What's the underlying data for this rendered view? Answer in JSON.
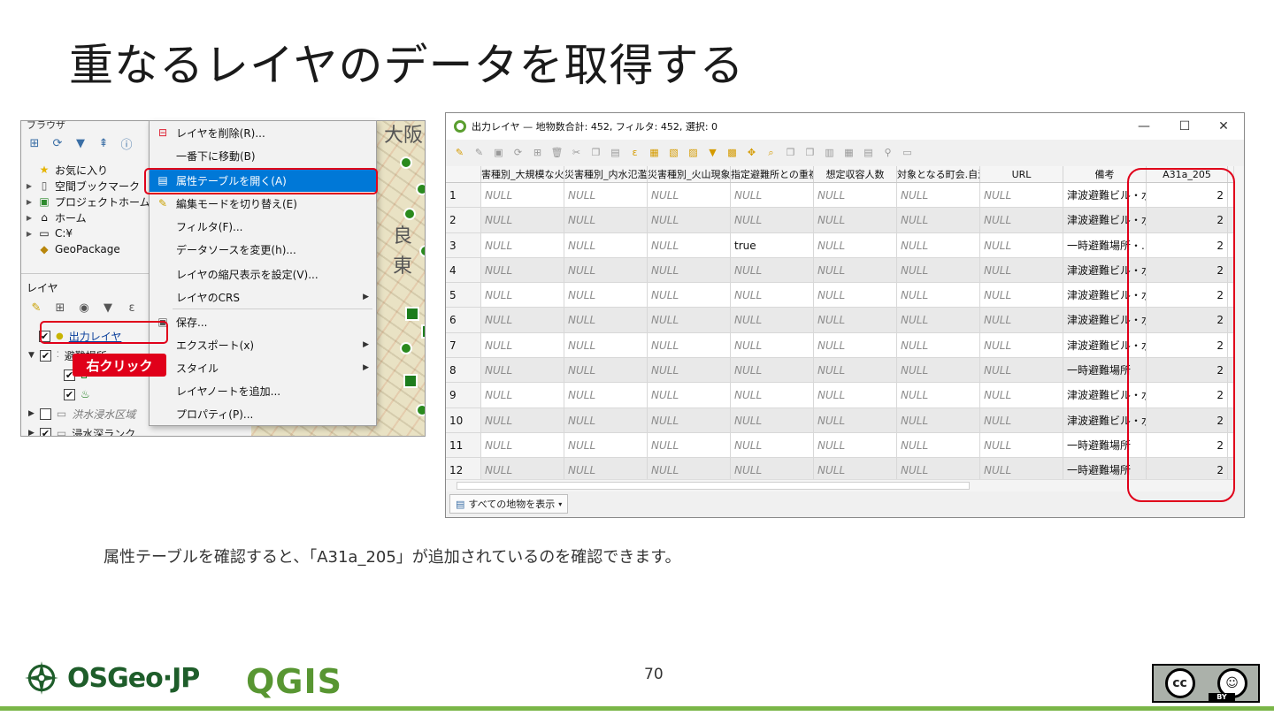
{
  "slide": {
    "title": "重なるレイヤのデータを取得する",
    "caption": "属性テーブルを確認すると、「A31a_205」が追加されているのを確認できます。",
    "page_number": "70"
  },
  "left_panel": {
    "cut_header": "ブラウザ",
    "browser_items": [
      {
        "label": "お気に入り",
        "icon": "star-icon"
      },
      {
        "label": "空間ブックマーク",
        "icon": "bookmark-icon"
      },
      {
        "label": "プロジェクトホーム",
        "icon": "project-home-icon"
      },
      {
        "label": "ホーム",
        "icon": "home-icon"
      },
      {
        "label": "C:¥",
        "icon": "folder-icon"
      },
      {
        "label": "GeoPackage",
        "icon": "geopackage-icon"
      }
    ],
    "layers_label": "レイヤ",
    "layers": [
      {
        "label": "出力レイヤ",
        "checked": "✔"
      },
      {
        "label": "避難場所",
        "checked": "✔"
      },
      {
        "label": "",
        "checked": "✔"
      },
      {
        "label": "",
        "checked": "✔"
      },
      {
        "label": "洪水浸水区域",
        "checked": ""
      },
      {
        "label": "浸水深ランク",
        "checked": "✔"
      }
    ],
    "right_click_label": "右クリック",
    "map_labels": [
      "大阪",
      "良",
      "東"
    ]
  },
  "context_menu": {
    "items": [
      {
        "label": "レイヤを削除(R)...",
        "icon": "remove-layer-icon"
      },
      {
        "label": "一番下に移動(B)",
        "icon": ""
      },
      {
        "label": "属性テーブルを開く(A)",
        "icon": "table-icon"
      },
      {
        "label": "編集モードを切り替え(E)",
        "icon": "pencil-icon"
      },
      {
        "label": "フィルタ(F)...",
        "icon": ""
      },
      {
        "label": "データソースを変更(h)...",
        "icon": ""
      },
      {
        "label": "レイヤの縮尺表示を設定(V)...",
        "icon": ""
      },
      {
        "label": "レイヤのCRS",
        "icon": ""
      },
      {
        "label": "保存...",
        "icon": "save-icon"
      },
      {
        "label": "エクスポート(x)",
        "icon": ""
      },
      {
        "label": "スタイル",
        "icon": ""
      },
      {
        "label": "レイヤノートを追加...",
        "icon": ""
      },
      {
        "label": "プロパティ(P)...",
        "icon": ""
      }
    ],
    "submenu_arrow": "▶"
  },
  "attribute_table": {
    "window_title": "出力レイヤ — 地物数合計: 452, フィルタ: 452, 選択: 0",
    "controls": {
      "minimize": "—",
      "maximize": "☐",
      "close": "✕"
    },
    "columns": [
      "",
      "災害種別_大規模な火",
      "災害種別_内水氾濫",
      "災害種別_火山現象",
      "指定避難所との重複",
      "想定収容人数",
      "対象となる町会.自治会",
      "URL",
      "備考",
      "A31a_205"
    ],
    "header_display": [
      "",
      "害種別_大規模な火",
      "災害種別_内水氾濫",
      "災害種別_火山現象",
      "指定避難所との重複",
      "想定収容人数",
      "対象となる町会.自治会",
      "URL",
      "備考",
      "A31a_205"
    ],
    "rows": [
      [
        "1",
        "NULL",
        "NULL",
        "NULL",
        "NULL",
        "NULL",
        "NULL",
        "NULL",
        "津波避難ビル・水...",
        "2"
      ],
      [
        "2",
        "NULL",
        "NULL",
        "NULL",
        "NULL",
        "NULL",
        "NULL",
        "NULL",
        "津波避難ビル・水...",
        "2"
      ],
      [
        "3",
        "NULL",
        "NULL",
        "NULL",
        "true",
        "NULL",
        "NULL",
        "NULL",
        "一時避難場所・...",
        "2"
      ],
      [
        "4",
        "NULL",
        "NULL",
        "NULL",
        "NULL",
        "NULL",
        "NULL",
        "NULL",
        "津波避難ビル・水...",
        "2"
      ],
      [
        "5",
        "NULL",
        "NULL",
        "NULL",
        "NULL",
        "NULL",
        "NULL",
        "NULL",
        "津波避難ビル・水...",
        "2"
      ],
      [
        "6",
        "NULL",
        "NULL",
        "NULL",
        "NULL",
        "NULL",
        "NULL",
        "NULL",
        "津波避難ビル・水...",
        "2"
      ],
      [
        "7",
        "NULL",
        "NULL",
        "NULL",
        "NULL",
        "NULL",
        "NULL",
        "NULL",
        "津波避難ビル・水...",
        "2"
      ],
      [
        "8",
        "NULL",
        "NULL",
        "NULL",
        "NULL",
        "NULL",
        "NULL",
        "NULL",
        "一時避難場所",
        "2"
      ],
      [
        "9",
        "NULL",
        "NULL",
        "NULL",
        "NULL",
        "NULL",
        "NULL",
        "NULL",
        "津波避難ビル・水...",
        "2"
      ],
      [
        "10",
        "NULL",
        "NULL",
        "NULL",
        "NULL",
        "NULL",
        "NULL",
        "NULL",
        "津波避難ビル・水...",
        "2"
      ],
      [
        "11",
        "NULL",
        "NULL",
        "NULL",
        "NULL",
        "NULL",
        "NULL",
        "NULL",
        "一時避難場所",
        "2"
      ],
      [
        "12",
        "NULL",
        "NULL",
        "NULL",
        "NULL",
        "NULL",
        "NULL",
        "NULL",
        "一時避難場所",
        "2"
      ]
    ],
    "status_button": "すべての地物を表示"
  },
  "footer": {
    "osgeo_text": "OSGeo·JP",
    "qgis_text": "QGIS",
    "license_cc": "cc",
    "license_by_icon": "person-icon",
    "license_label": "BY"
  },
  "colors": {
    "highlight": "#e0001a",
    "menu_active": "#0078d7",
    "footer_green": "#7ab648",
    "qgis_green": "#589632"
  }
}
